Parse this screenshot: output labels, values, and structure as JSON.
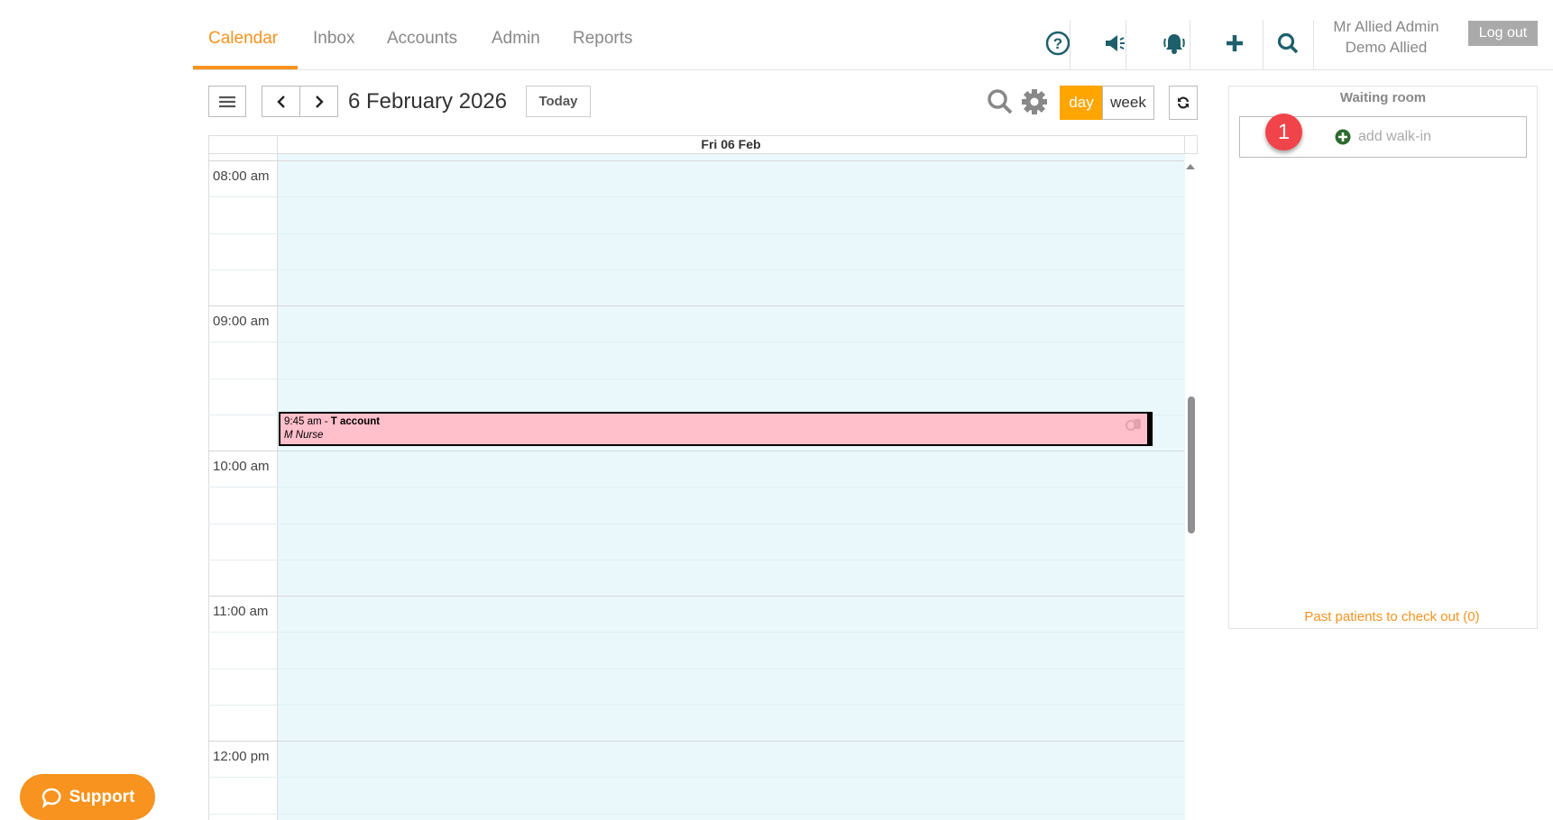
{
  "nav": {
    "tabs": [
      {
        "label": "Calendar",
        "active": true
      },
      {
        "label": "Inbox"
      },
      {
        "label": "Accounts"
      },
      {
        "label": "Admin"
      },
      {
        "label": "Reports"
      }
    ]
  },
  "user": {
    "name": "Mr Allied Admin",
    "org": "Demo Allied",
    "logout": "Log out"
  },
  "toolbar": {
    "date": "6 February 2026",
    "today": "Today",
    "day": "day",
    "week": "week"
  },
  "calendar": {
    "day_header": "Fri 06 Feb",
    "times": [
      "08:00 am",
      "09:00 am",
      "10:00 am",
      "11:00 am",
      "12:00 pm"
    ],
    "event": {
      "time": "9:45 am - ",
      "title": "T account",
      "practitioner": "M Nurse",
      "color": "#ffbfcb"
    }
  },
  "waiting": {
    "title": "Waiting room",
    "add": "add walk-in",
    "badge": "1",
    "past": "Past patients to check out (0)"
  },
  "support": {
    "label": "Support"
  },
  "colors": {
    "accent": "#f7931e",
    "teal": "#1d5f6b",
    "grid": "#eaf8fc"
  }
}
